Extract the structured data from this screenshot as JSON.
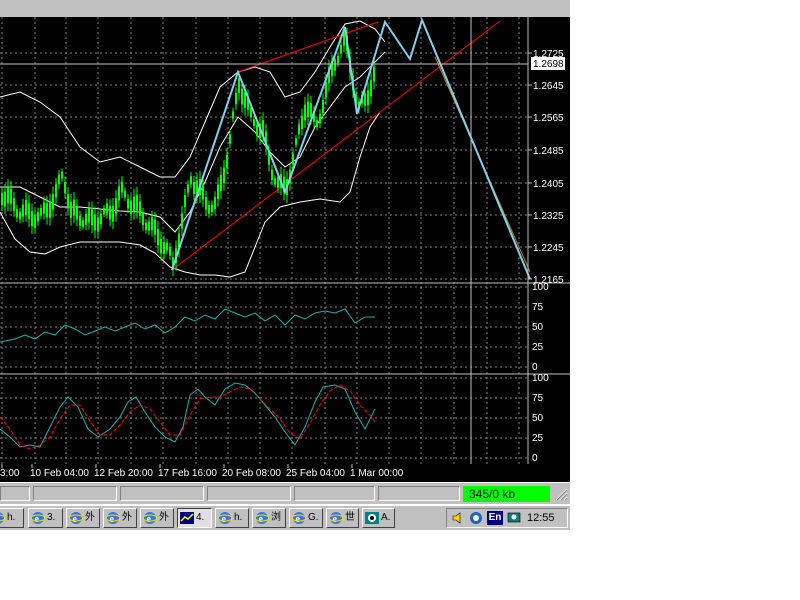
{
  "price_axis": {
    "labels": [
      "1.2725",
      "1.2645",
      "1.2565",
      "1.2485",
      "1.2405",
      "1.2325",
      "1.2245",
      "1.2165"
    ],
    "current_price": "1.2698"
  },
  "rsi_axis": {
    "labels": [
      "100",
      "75",
      "50",
      "25",
      "0"
    ]
  },
  "stoch_axis": {
    "labels": [
      "100",
      "75",
      "50",
      "25",
      "0"
    ]
  },
  "time_axis": {
    "labels": [
      "3:00",
      "10 Feb 04:00",
      "12 Feb 20:00",
      "17 Feb 16:00",
      "20 Feb 08:00",
      "25 Feb 04:00",
      "1 Mar 00:00"
    ]
  },
  "status_bar": {
    "traffic": "345/0 kb"
  },
  "taskbar": {
    "buttons": [
      {
        "label": "h.",
        "icon": "ie-icon"
      },
      {
        "label": "3.",
        "icon": "ie-icon"
      },
      {
        "label": "外",
        "icon": "ie-icon"
      },
      {
        "label": "外",
        "icon": "ie-icon"
      },
      {
        "label": "外",
        "icon": "ie-icon"
      },
      {
        "label": "4.",
        "icon": "metatrader-icon"
      },
      {
        "label": "h.",
        "icon": "ie-icon"
      },
      {
        "label": "浏",
        "icon": "ie-icon"
      },
      {
        "label": "G.",
        "icon": "ie-icon"
      },
      {
        "label": "世",
        "icon": "ie-icon"
      },
      {
        "label": "A.",
        "icon": "app-icon"
      }
    ],
    "tray": {
      "language": "En",
      "clock": "12:55"
    }
  },
  "colors": {
    "chart_bg": "#000000",
    "grid": "#c0c0c0",
    "candle": "#00ff00",
    "bollinger": "#ffffff",
    "zigzag": "#87ceeb",
    "channel": "#ff0000",
    "rsi_line": "#20b2aa",
    "stoch_main": "#20b2aa",
    "stoch_signal": "#ff0000",
    "traffic_bg": "#00ff00"
  }
}
